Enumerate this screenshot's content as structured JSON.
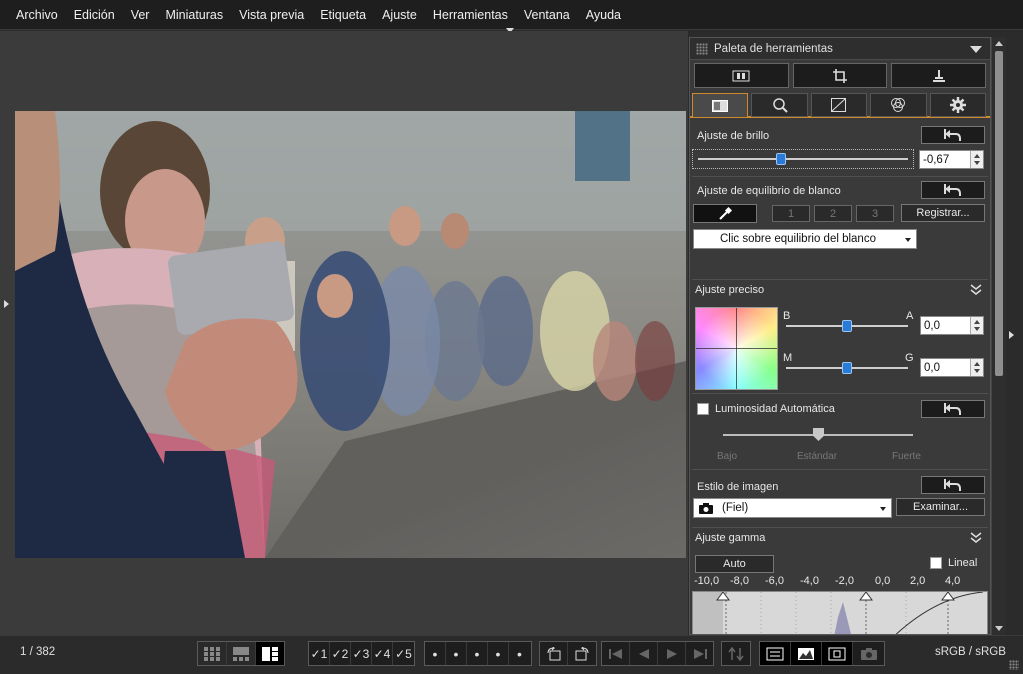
{
  "menu": {
    "items": [
      "Archivo",
      "Edición",
      "Ver",
      "Miniaturas",
      "Vista previa",
      "Etiqueta",
      "Ajuste",
      "Herramientas",
      "Ventana",
      "Ayuda"
    ]
  },
  "palette": {
    "title": "Paleta de herramientas",
    "toolbar_icons": [
      "filmstrip-icon",
      "crop-icon",
      "stamp-icon"
    ],
    "tabs": [
      "basic-adjust-icon",
      "detail-magnify-icon",
      "tone-curve-icon",
      "color-wheel-icon",
      "gear-icon"
    ],
    "brightness": {
      "label": "Ajuste de brillo",
      "value": "-0,67",
      "slider_fraction": 0.395
    },
    "white_balance": {
      "label": "Ajuste de equilibrio de blanco",
      "presets": [
        "1",
        "2",
        "3"
      ],
      "register_label": "Registrar...",
      "mode_value": "Clic sobre equilibrio del blanco"
    },
    "fine_adjust": {
      "label": "Ajuste preciso",
      "ba_left": "B",
      "ba_right": "A",
      "ba_value": "0,0",
      "mg_left": "M",
      "mg_right": "G",
      "mg_value": "0,0"
    },
    "auto_lighting": {
      "label": "Luminosidad Automática",
      "levels": [
        "Bajo",
        "Estándar",
        "Fuerte"
      ],
      "slider_fraction": 0.5
    },
    "picture_style": {
      "label": "Estilo de imagen",
      "value": "(Fiel)",
      "browse_label": "Examinar..."
    },
    "gamma": {
      "label": "Ajuste gamma",
      "auto_label": "Auto",
      "linear_label": "Lineal",
      "ticks": [
        "-10,0",
        "-8,0",
        "-6,0",
        "-4,0",
        "-2,0",
        "0,0",
        "2,0",
        "4,0"
      ]
    }
  },
  "status": {
    "count": "1 / 382",
    "color_space": "sRGB / sRGB",
    "view_mode_icons": [
      "grid-icon",
      "list-icon",
      "single-view-icon"
    ],
    "check_marks": [
      "✓1",
      "✓2",
      "✓3",
      "✓4",
      "✓5"
    ],
    "ratings": [
      "•",
      "•",
      "•",
      "•",
      "•"
    ],
    "rotate_icons": [
      "rotate-left-icon",
      "rotate-right-icon"
    ],
    "nav_icons": [
      "first-icon",
      "prev-icon",
      "next-icon",
      "last-icon"
    ],
    "tool_icons": [
      "sort-icon",
      "compare-icon",
      "histogram-icon",
      "focus-icon",
      "camera-icon"
    ]
  }
}
